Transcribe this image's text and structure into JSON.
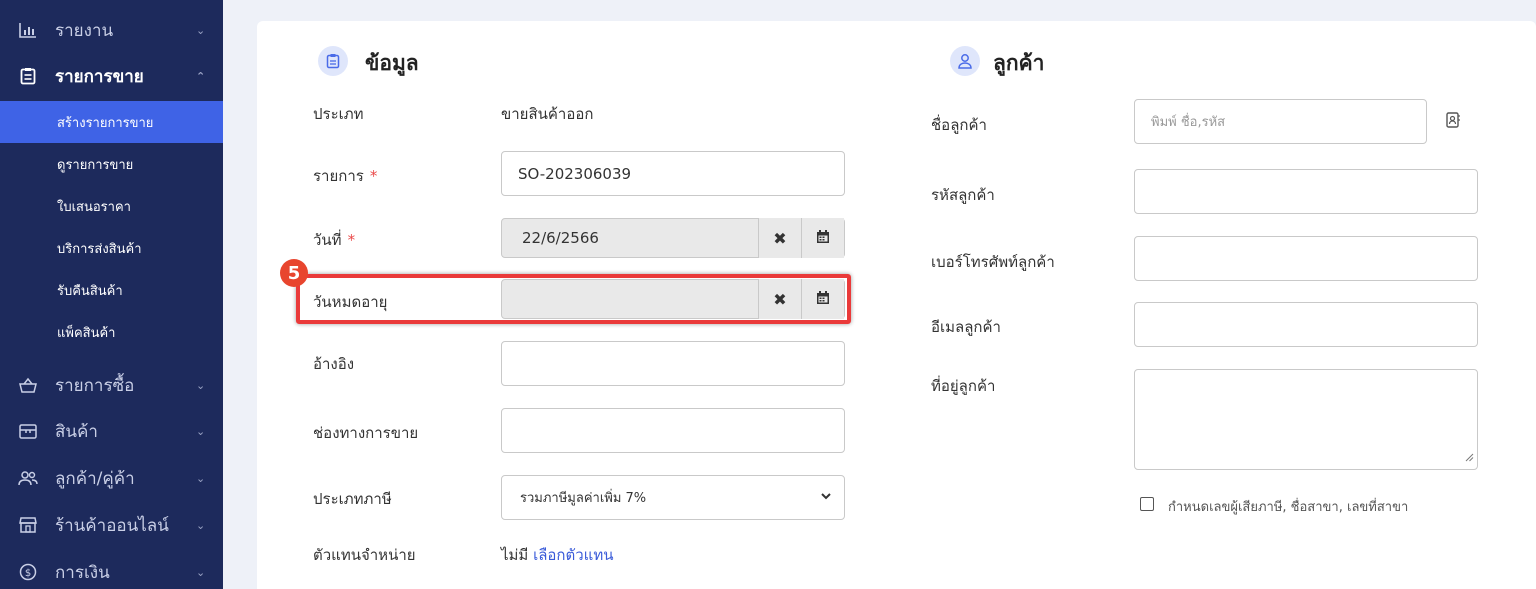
{
  "sidebar": {
    "items": [
      {
        "label": "รายงาน",
        "icon": "bar-chart-icon",
        "chevron": "⌄"
      },
      {
        "label": "รายการขาย",
        "icon": "clipboard-icon",
        "chevron": "⌃"
      },
      {
        "label": "รายการซื้อ",
        "icon": "basket-icon",
        "chevron": "⌄"
      },
      {
        "label": "สินค้า",
        "icon": "box-icon",
        "chevron": "⌄"
      },
      {
        "label": "ลูกค้า/คู่ค้า",
        "icon": "users-icon",
        "chevron": "⌄"
      },
      {
        "label": "ร้านค้าออนไลน์",
        "icon": "store-icon",
        "chevron": "⌄"
      },
      {
        "label": "การเงิน",
        "icon": "dollar-circle-icon",
        "chevron": "⌄"
      }
    ],
    "sub_items": [
      {
        "label": "สร้างรายการขาย",
        "active": true
      },
      {
        "label": "ดูรายการขาย"
      },
      {
        "label": "ใบเสนอราคา"
      },
      {
        "label": "บริการส่งสินค้า"
      },
      {
        "label": "รับคืนสินค้า"
      },
      {
        "label": "แพ็คสินค้า"
      }
    ]
  },
  "info": {
    "title": "ข้อมูล",
    "type_label": "ประเภท",
    "type_value": "ขายสินค้าออก",
    "doc_label": "รายการ",
    "doc_value": "SO-202306039",
    "required_mark": "*",
    "date_label": "วันที่",
    "date_value": "22/6/2566",
    "expiry_label": "วันหมดอายุ",
    "expiry_value": "",
    "ref_label": "อ้างอิง",
    "channel_label": "ช่องทางการขาย",
    "tax_label": "ประเภทภาษี",
    "tax_value": "รวมภาษีมูลค่าเพิ่ม 7%",
    "agent_label": "ตัวแทนจำหน่าย",
    "agent_none": "ไม่มี",
    "agent_link": "เลือกตัวแทน"
  },
  "customer": {
    "title": "ลูกค้า",
    "name_label": "ชื่อลูกค้า",
    "name_placeholder": "พิมพ์ ชื่อ,รหัส",
    "code_label": "รหัสลูกค้า",
    "phone_label": "เบอร์โทรศัพท์ลูกค้า",
    "email_label": "อีเมลลูกค้า",
    "address_label": "ที่อยู่ลูกค้า",
    "tax_checkbox_label": "กำหนดเลขผู้เสียภาษี, ชื่อสาขา, เลขที่สาขา"
  },
  "annotation": {
    "step": "5"
  },
  "colors": {
    "sidebar": "#1d2a5c",
    "active": "#3f63e6",
    "highlight": "#ea3a3a",
    "required": "#ea4a4a",
    "link": "#3a5bd9"
  }
}
